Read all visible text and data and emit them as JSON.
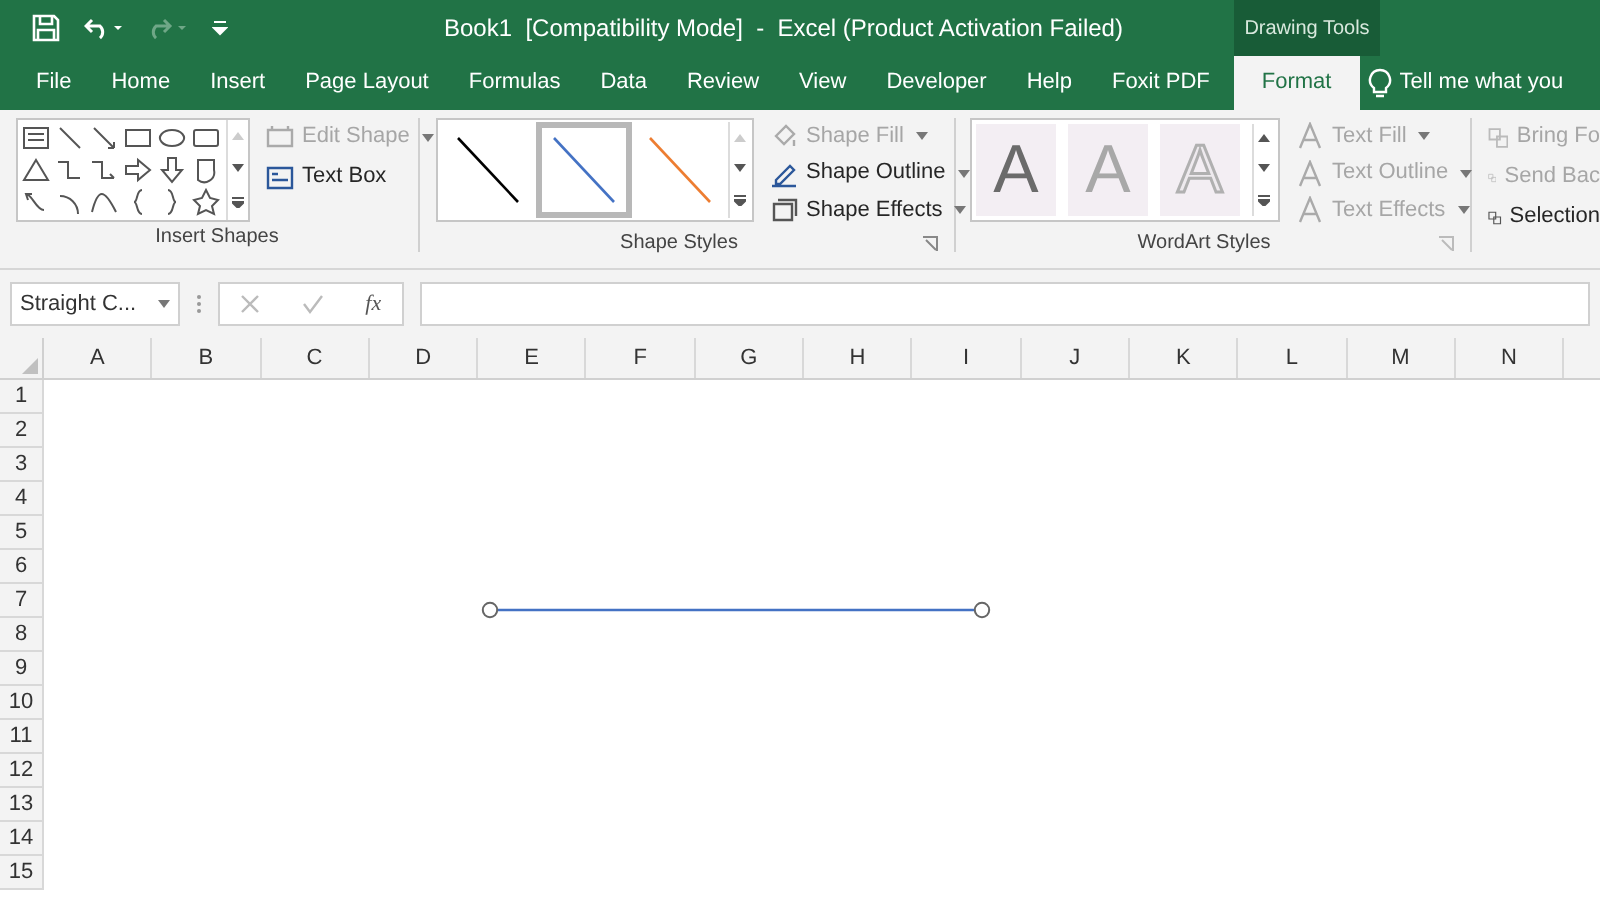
{
  "window": {
    "title": "Book1  [Compatibility Mode]  -  Excel (Product Activation Failed)",
    "context_group": "Drawing Tools"
  },
  "tabs": [
    {
      "label": "File",
      "selected": false
    },
    {
      "label": "Home",
      "selected": false
    },
    {
      "label": "Insert",
      "selected": false
    },
    {
      "label": "Page Layout",
      "selected": false
    },
    {
      "label": "Formulas",
      "selected": false
    },
    {
      "label": "Data",
      "selected": false
    },
    {
      "label": "Review",
      "selected": false
    },
    {
      "label": "View",
      "selected": false
    },
    {
      "label": "Developer",
      "selected": false
    },
    {
      "label": "Help",
      "selected": false
    },
    {
      "label": "Foxit PDF",
      "selected": false
    },
    {
      "label": "Format",
      "selected": true
    }
  ],
  "tell_me": {
    "placeholder": "Tell me what you"
  },
  "insert_shapes": {
    "label": "Insert Shapes",
    "buttons": [
      {
        "label": "Edit Shape",
        "disabled": true
      },
      {
        "label": "Text Box",
        "disabled": false
      }
    ]
  },
  "shape_styles": {
    "label": "Shape Styles",
    "styles": [
      {
        "color": "#000000",
        "selected": false
      },
      {
        "color": "#4472c4",
        "selected": true
      },
      {
        "color": "#ed7d31",
        "selected": false
      }
    ],
    "buttons": [
      {
        "label": "Shape Fill",
        "disabled": true
      },
      {
        "label": "Shape Outline",
        "disabled": false
      },
      {
        "label": "Shape Effects",
        "disabled": false
      }
    ]
  },
  "wordart_styles": {
    "label": "WordArt Styles",
    "samples": [
      {
        "text": "A",
        "kind": "fill"
      },
      {
        "text": "A",
        "kind": "light"
      },
      {
        "text": "A",
        "kind": "outline"
      }
    ],
    "buttons": [
      {
        "label": "Text Fill",
        "disabled": true
      },
      {
        "label": "Text Outline",
        "disabled": true
      },
      {
        "label": "Text Effects",
        "disabled": true
      }
    ]
  },
  "arrange": {
    "buttons": [
      {
        "label": "Bring Fo",
        "disabled": true
      },
      {
        "label": "Send Bac",
        "disabled": true
      },
      {
        "label": "Selection",
        "disabled": false
      }
    ]
  },
  "formula_bar": {
    "name_box": "Straight C...",
    "function_label": "fx"
  },
  "sheet": {
    "columns": [
      "A",
      "B",
      "C",
      "D",
      "E",
      "F",
      "G",
      "H",
      "I",
      "J",
      "K",
      "L",
      "M",
      "N"
    ],
    "rows": [
      "1",
      "2",
      "3",
      "4",
      "5",
      "6",
      "7",
      "8",
      "9",
      "10",
      "11",
      "12",
      "13",
      "14",
      "15"
    ]
  }
}
